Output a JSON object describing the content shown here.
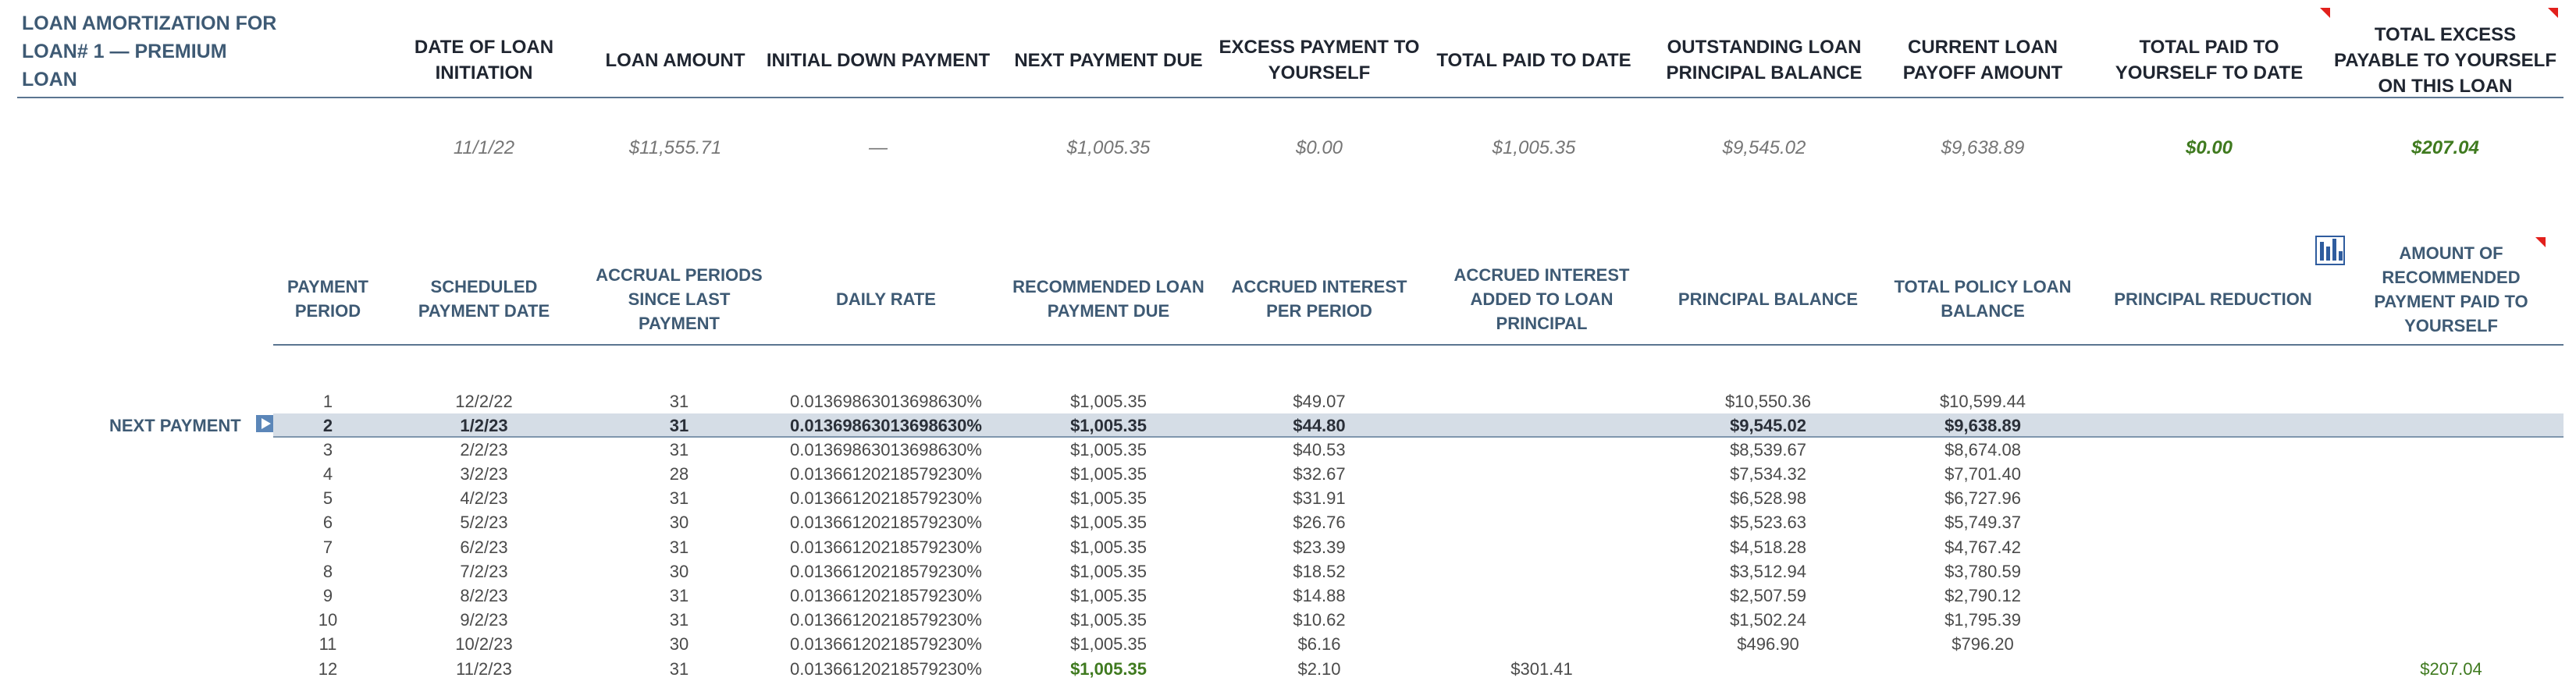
{
  "title": "LOAN AMORTIZATION FOR LOAN# 1 — PREMIUM LOAN",
  "summary": {
    "headers": {
      "date_of_loan_initiation": "DATE OF LOAN INITIATION",
      "loan_amount": "LOAN AMOUNT",
      "initial_down_payment": "INITIAL DOWN PAYMENT",
      "next_payment_due": "NEXT PAYMENT DUE",
      "excess_payment_to_yourself": "EXCESS PAYMENT TO YOURSELF",
      "total_paid_to_date": "TOTAL PAID TO DATE",
      "outstanding_loan_principal_balance": "OUTSTANDING LOAN PRINCIPAL BALANCE",
      "current_loan_payoff_amount": "CURRENT LOAN PAYOFF AMOUNT",
      "total_paid_to_yourself_to_date": "TOTAL PAID TO YOURSELF TO DATE",
      "total_excess_payable_to_yourself": "TOTAL EXCESS PAYABLE TO YOURSELF ON THIS LOAN"
    },
    "values": {
      "date_of_loan_initiation": "11/1/22",
      "loan_amount": "$11,555.71",
      "initial_down_payment": "—",
      "next_payment_due": "$1,005.35",
      "excess_payment_to_yourself": "$0.00",
      "total_paid_to_date": "$1,005.35",
      "outstanding_loan_principal_balance": "$9,545.02",
      "current_loan_payoff_amount": "$9,638.89",
      "total_paid_to_yourself_to_date": "$0.00",
      "total_excess_payable_to_yourself": "$207.04"
    }
  },
  "table": {
    "headers": {
      "payment_period": "PAYMENT PERIOD",
      "scheduled_payment_date": "SCHEDULED PAYMENT DATE",
      "accrual_periods": "ACCRUAL PERIODS SINCE LAST PAYMENT",
      "daily_rate": "DAILY RATE",
      "recommended_payment": "RECOMMENDED LOAN PAYMENT DUE",
      "accrued_interest": "ACCRUED INTEREST PER PERIOD",
      "accrued_interest_added": "ACCRUED INTEREST ADDED TO LOAN PRINCIPAL",
      "principal_balance": "PRINCIPAL BALANCE",
      "total_policy_loan_balance": "TOTAL POLICY LOAN BALANCE",
      "principal_reduction": "PRINCIPAL REDUCTION",
      "amount_paid_to_yourself": "AMOUNT OF RECOMMENDED PAYMENT PAID TO YOURSELF"
    },
    "next_payment_label": "NEXT PAYMENT",
    "rows": [
      {
        "period": "1",
        "date": "12/2/22",
        "accrual": "31",
        "rate": "0.01369863013698630%",
        "payment": "$1,005.35",
        "interest": "$49.07",
        "interest_added": "",
        "principal": "$10,550.36",
        "total_balance": "$10,599.44",
        "reduction": "",
        "paid_to_yourself": ""
      },
      {
        "period": "2",
        "date": "1/2/23",
        "accrual": "31",
        "rate": "0.01369863013698630%",
        "payment": "$1,005.35",
        "interest": "$44.80",
        "interest_added": "",
        "principal": "$9,545.02",
        "total_balance": "$9,638.89",
        "reduction": "",
        "paid_to_yourself": ""
      },
      {
        "period": "3",
        "date": "2/2/23",
        "accrual": "31",
        "rate": "0.01369863013698630%",
        "payment": "$1,005.35",
        "interest": "$40.53",
        "interest_added": "",
        "principal": "$8,539.67",
        "total_balance": "$8,674.08",
        "reduction": "",
        "paid_to_yourself": ""
      },
      {
        "period": "4",
        "date": "3/2/23",
        "accrual": "28",
        "rate": "0.01366120218579230%",
        "payment": "$1,005.35",
        "interest": "$32.67",
        "interest_added": "",
        "principal": "$7,534.32",
        "total_balance": "$7,701.40",
        "reduction": "",
        "paid_to_yourself": ""
      },
      {
        "period": "5",
        "date": "4/2/23",
        "accrual": "31",
        "rate": "0.01366120218579230%",
        "payment": "$1,005.35",
        "interest": "$31.91",
        "interest_added": "",
        "principal": "$6,528.98",
        "total_balance": "$6,727.96",
        "reduction": "",
        "paid_to_yourself": ""
      },
      {
        "period": "6",
        "date": "5/2/23",
        "accrual": "30",
        "rate": "0.01366120218579230%",
        "payment": "$1,005.35",
        "interest": "$26.76",
        "interest_added": "",
        "principal": "$5,523.63",
        "total_balance": "$5,749.37",
        "reduction": "",
        "paid_to_yourself": ""
      },
      {
        "period": "7",
        "date": "6/2/23",
        "accrual": "31",
        "rate": "0.01366120218579230%",
        "payment": "$1,005.35",
        "interest": "$23.39",
        "interest_added": "",
        "principal": "$4,518.28",
        "total_balance": "$4,767.42",
        "reduction": "",
        "paid_to_yourself": ""
      },
      {
        "period": "8",
        "date": "7/2/23",
        "accrual": "30",
        "rate": "0.01366120218579230%",
        "payment": "$1,005.35",
        "interest": "$18.52",
        "interest_added": "",
        "principal": "$3,512.94",
        "total_balance": "$3,780.59",
        "reduction": "",
        "paid_to_yourself": ""
      },
      {
        "period": "9",
        "date": "8/2/23",
        "accrual": "31",
        "rate": "0.01366120218579230%",
        "payment": "$1,005.35",
        "interest": "$14.88",
        "interest_added": "",
        "principal": "$2,507.59",
        "total_balance": "$2,790.12",
        "reduction": "",
        "paid_to_yourself": ""
      },
      {
        "period": "10",
        "date": "9/2/23",
        "accrual": "31",
        "rate": "0.01366120218579230%",
        "payment": "$1,005.35",
        "interest": "$10.62",
        "interest_added": "",
        "principal": "$1,502.24",
        "total_balance": "$1,795.39",
        "reduction": "",
        "paid_to_yourself": ""
      },
      {
        "period": "11",
        "date": "10/2/23",
        "accrual": "30",
        "rate": "0.01366120218579230%",
        "payment": "$1,005.35",
        "interest": "$6.16",
        "interest_added": "",
        "principal": "$496.90",
        "total_balance": "$796.20",
        "reduction": "",
        "paid_to_yourself": ""
      },
      {
        "period": "12",
        "date": "11/2/23",
        "accrual": "31",
        "rate": "0.01366120218579230%",
        "payment": "$1,005.35",
        "interest": "$2.10",
        "interest_added": "$301.41",
        "principal": "",
        "total_balance": "",
        "reduction": "",
        "paid_to_yourself": "$207.04"
      }
    ]
  },
  "colors": {
    "header_text": "#3e5a74",
    "rule": "#5b7590",
    "highlight_row": "#d5dde6",
    "positive_green": "#3f7a1f",
    "comment_marker": "#e2201c"
  },
  "icons": {
    "next_payment_marker": "play-arrow-icon",
    "chart_button": "bar-chart-icon"
  }
}
